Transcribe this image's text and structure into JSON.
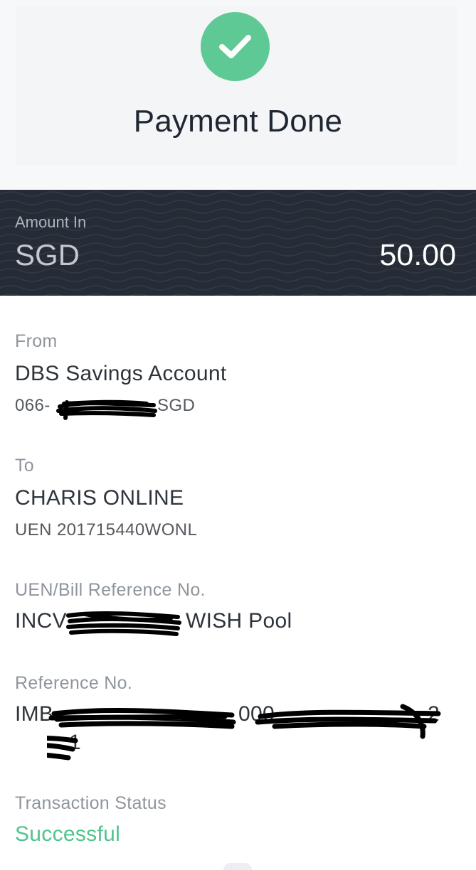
{
  "header": {
    "icon": "checkmark-icon",
    "title": "Payment Done",
    "accent_color": "#5ec994"
  },
  "amount": {
    "label": "Amount In",
    "currency": "SGD",
    "value": "50.00"
  },
  "from": {
    "label": "From",
    "account_name": "DBS Savings Account",
    "account_prefix": "066-",
    "account_suffix": "SGD"
  },
  "to": {
    "label": "To",
    "payee_name": "CHARIS ONLINE",
    "uen": "UEN 201715440WONL"
  },
  "bill_reference": {
    "label": "UEN/Bill Reference No.",
    "prefix": "INCV",
    "suffix": "WISH Pool"
  },
  "reference": {
    "label": "Reference No.",
    "line1_prefix": "IMB",
    "line1_mid": "000",
    "line1_end": "2",
    "line2_end": "1"
  },
  "status": {
    "label": "Transaction Status",
    "value": "Successful",
    "color": "#4fc48e"
  }
}
